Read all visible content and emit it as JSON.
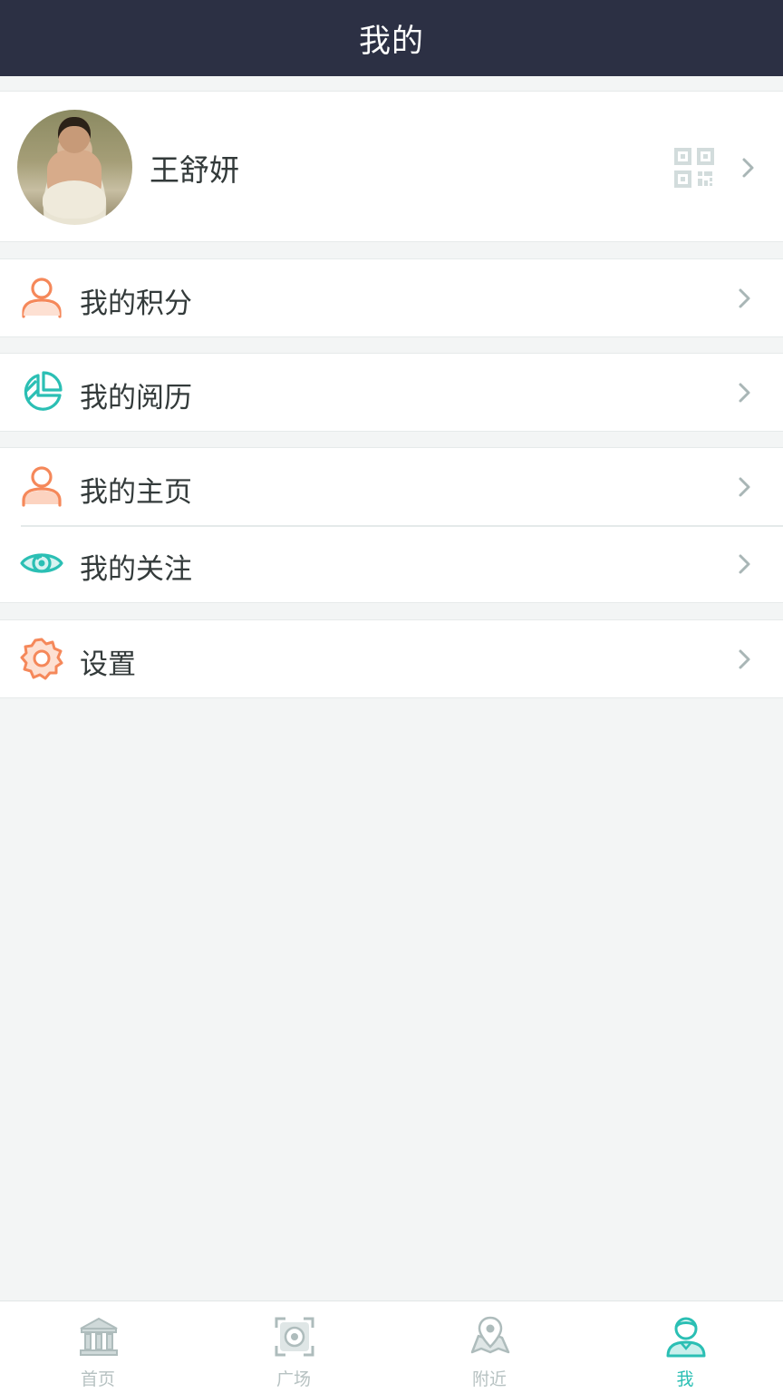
{
  "header": {
    "title": "我的"
  },
  "profile": {
    "name": "王舒妍"
  },
  "menu": {
    "points": "我的积分",
    "history": "我的阅历",
    "homepage": "我的主页",
    "following": "我的关注",
    "settings": "设置"
  },
  "tabs": [
    {
      "label": "首页",
      "icon": "bank-icon"
    },
    {
      "label": "广场",
      "icon": "scan-icon"
    },
    {
      "label": "附近",
      "icon": "map-pin-icon"
    },
    {
      "label": "我",
      "icon": "user-icon",
      "active": true
    }
  ],
  "colors": {
    "header_bg": "#2c3044",
    "accent_teal": "#2bbfb4",
    "accent_orange": "#f5885a",
    "icon_gray": "#b7c2c2"
  }
}
